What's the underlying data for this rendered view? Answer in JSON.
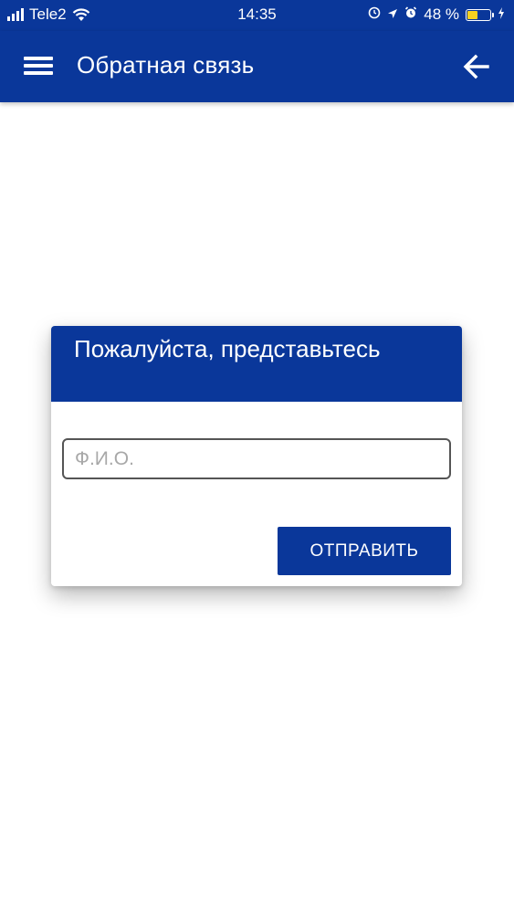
{
  "status_bar": {
    "carrier": "Tele2",
    "time": "14:35",
    "battery_percent_label": "48 %",
    "battery_level": 0.48,
    "battery_color": "#f5d120"
  },
  "app_bar": {
    "title": "Обратная связь",
    "menu_icon": "hamburger-menu-icon",
    "back_icon": "arrow-left-icon",
    "color": "#0a379a"
  },
  "dialog": {
    "title": "Пожалуйста, представьтесь",
    "input_placeholder": "Ф.И.О.",
    "input_value": "",
    "submit_label": "ОТПРАВИТЬ"
  }
}
